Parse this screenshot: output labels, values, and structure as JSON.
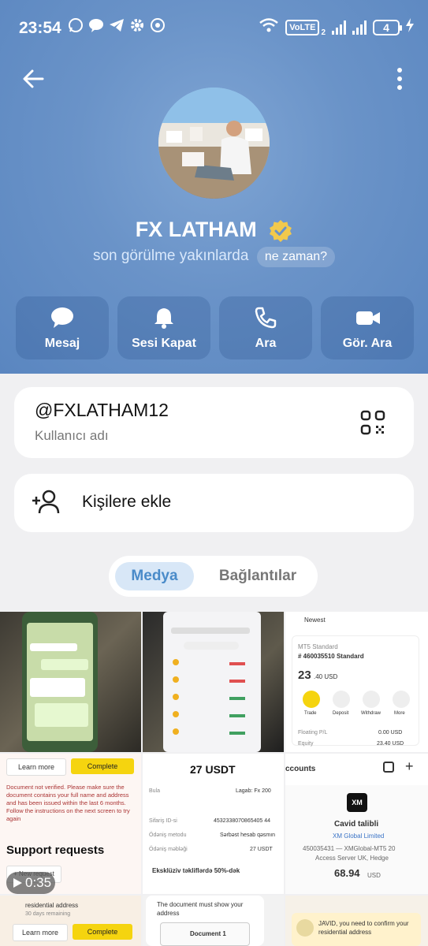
{
  "status_bar": {
    "time": "23:54",
    "network": "VoLTE",
    "sim_index": "2",
    "battery": "4"
  },
  "profile": {
    "name": "FX LATHAM",
    "last_seen": "son görülme yakınlarda",
    "when_chip": "ne zaman?",
    "accent": "#6a93c8"
  },
  "actions": [
    {
      "label": "Mesaj",
      "icon": "chat-bubble-icon"
    },
    {
      "label": "Sesi Kapat",
      "icon": "bell-icon"
    },
    {
      "label": "Ara",
      "icon": "phone-icon"
    },
    {
      "label": "Gör. Ara",
      "icon": "video-camera-icon"
    }
  ],
  "user_card": {
    "username": "@FXLATHAM12",
    "username_label": "Kullanıcı adı"
  },
  "contact_card": {
    "label": "Kişilere ekle"
  },
  "media_tabs": [
    {
      "label": "Medya",
      "active": true
    },
    {
      "label": "Bağlantılar",
      "active": false
    }
  ],
  "media": {
    "video_duration": "0:35",
    "t3": {
      "filter": "Newest",
      "account_line": "# 460035510 Standard",
      "mt5": "MT5   Standard",
      "balance": "23",
      "balance_dec": ".40 USD",
      "buttons": [
        "Trade",
        "Deposit",
        "Withdraw",
        "More"
      ],
      "floating_label": "Floating P/L",
      "floating_value": "0.00 USD",
      "equity_label": "Equity",
      "equity_value": "23.40 USD"
    },
    "t4": {
      "learn_more": "Learn more",
      "complete": "Complete",
      "notice": "Document not verified. Please make sure the document contains your full name and address and has been issued within the last 6 months. Follow the instructions on the next screen to try again",
      "support_title": "Support requests",
      "new_request": "+ New request"
    },
    "t5": {
      "amount": "27 USDT",
      "rows": [
        {
          "label": "Bula",
          "value": "Lagab: Fx 200"
        },
        {
          "label": "Sifariş ID-si",
          "value": "4532338070865405 44"
        },
        {
          "label": "Ödəniş metodu",
          "value": "Sərbəst hesab qəsmın"
        },
        {
          "label": "Ödəniş məbləği",
          "value": "27 USDT"
        }
      ],
      "promo": "Eksklüziv təkliflərdə 50%-dək"
    },
    "t6": {
      "header": "ccounts",
      "name": "Cavid talibli",
      "company": "XM Global Limited",
      "account": "450035431 — XMGlobal-MT5 20",
      "server": "Access Server UK, Hedge",
      "balance": "68.94",
      "currency": "USD"
    },
    "t7": {
      "address": "residential address",
      "days": "30 days remaining",
      "learn_more": "Learn more",
      "complete": "Complete"
    },
    "t8": {
      "text": "The document must show your address",
      "doc": "Document 1"
    },
    "t9": {
      "text": "JAVID, you need to confirm your residential address"
    }
  }
}
